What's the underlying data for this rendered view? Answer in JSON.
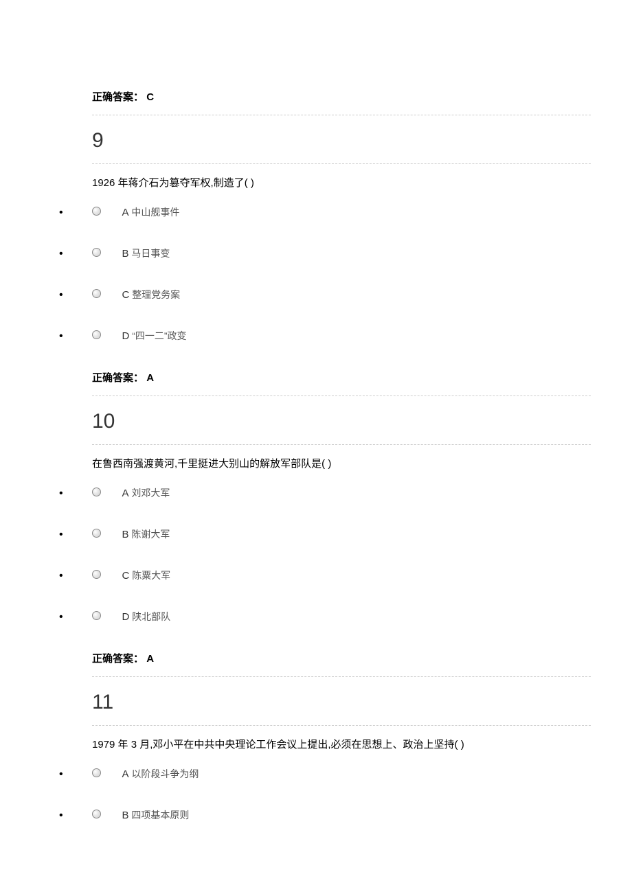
{
  "questions": [
    {
      "number": "9",
      "text": "1926 年蒋介石为篡夺军权,制造了( )",
      "options": [
        {
          "letter": "A",
          "label": "中山舰事件"
        },
        {
          "letter": "B",
          "label": "马日事变"
        },
        {
          "letter": "C",
          "label": "整理党务案"
        },
        {
          "letter": "D",
          "label": "“四一二”政变"
        }
      ],
      "answer_prefix": "正确答案：",
      "answer": "A",
      "leading_answer_prefix": "正确答案：",
      "leading_answer": "C"
    },
    {
      "number": "10",
      "text": "在鲁西南强渡黄河,千里挺进大别山的解放军部队是( )",
      "options": [
        {
          "letter": "A",
          "label": "刘邓大军"
        },
        {
          "letter": "B",
          "label": "陈谢大军"
        },
        {
          "letter": "C",
          "label": "陈粟大军"
        },
        {
          "letter": "D",
          "label": "陕北部队"
        }
      ],
      "answer_prefix": "正确答案：",
      "answer": "A"
    },
    {
      "number": "11",
      "text": "1979 年 3 月,邓小平在中共中央理论工作会议上提出,必须在思想上、政治上坚持( )",
      "options": [
        {
          "letter": "A",
          "label": "以阶段斗争为纲"
        },
        {
          "letter": "B",
          "label": "四项基本原则"
        }
      ]
    }
  ]
}
